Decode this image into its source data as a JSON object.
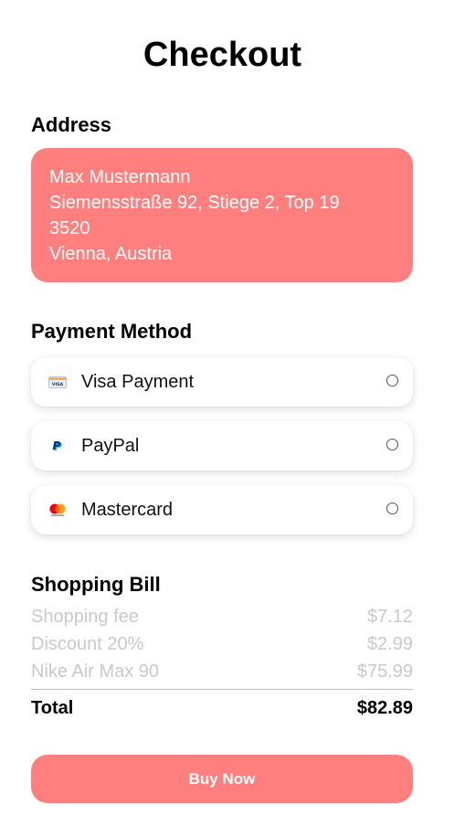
{
  "page": {
    "title": "Checkout"
  },
  "address": {
    "heading": "Address",
    "name": "Max Mustermann",
    "street": "Siemensstraße 92, Stiege 2, Top 19",
    "postal_code": "3520",
    "city_country": "Vienna, Austria",
    "card_color": "#ff7f7e"
  },
  "payment": {
    "heading": "Payment Method",
    "options": [
      {
        "label": "Visa Payment",
        "icon": "visa-card-icon",
        "selected": false
      },
      {
        "label": "PayPal",
        "icon": "paypal-icon",
        "selected": false
      },
      {
        "label": "Mastercard",
        "icon": "mastercard-icon",
        "selected": false
      }
    ]
  },
  "bill": {
    "heading": "Shopping Bill",
    "items": [
      {
        "label": "Shopping fee",
        "amount": "$7.12"
      },
      {
        "label": "Discount 20%",
        "amount": "$2.99"
      },
      {
        "label": "Nike Air Max 90",
        "amount": "$75.99"
      }
    ],
    "total_label": "Total",
    "total_amount": "$82.89"
  },
  "actions": {
    "buy_label": "Buy Now",
    "accent_color": "#ff7f7e"
  }
}
